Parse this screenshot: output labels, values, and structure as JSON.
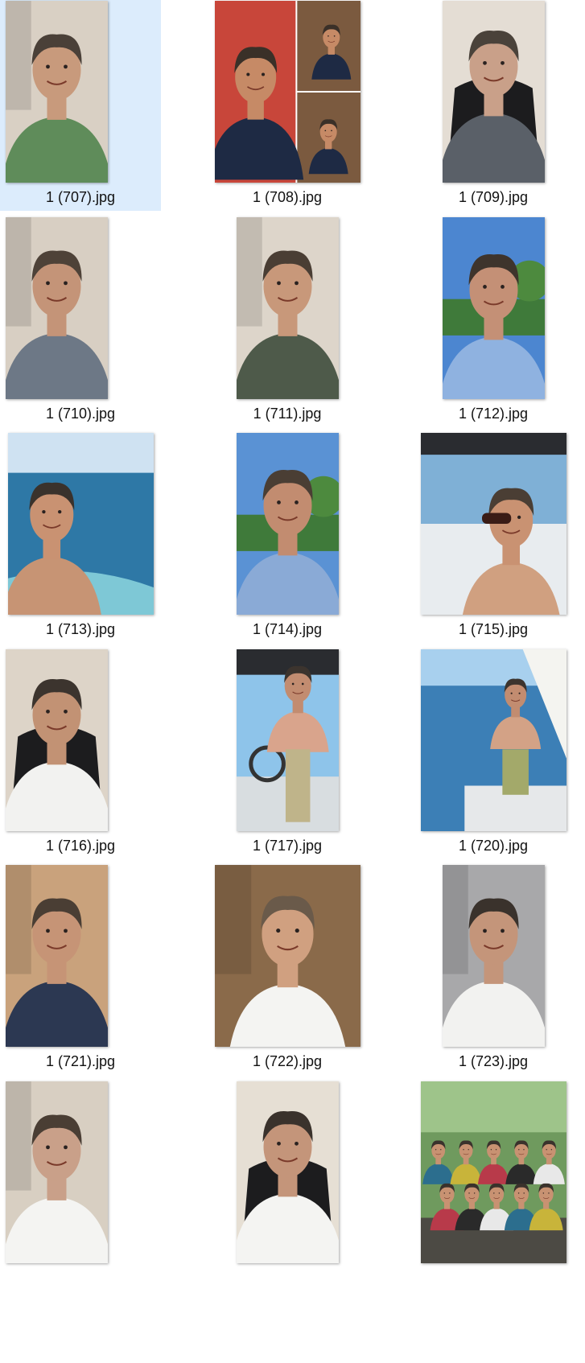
{
  "files": [
    {
      "name": "1 (707).jpg",
      "selected": true,
      "shape": "portrait",
      "scene": "selfie-indoor",
      "colors": {
        "bg": "#d9d0c4",
        "shirt": "#5f8c5a",
        "hair": "#4a4038",
        "skin": "#c89a7c"
      }
    },
    {
      "name": "1 (708).jpg",
      "selected": false,
      "shape": "landscape",
      "scene": "collage",
      "colors": {
        "bg": "#c8463a",
        "shirt": "#1e2a44",
        "hair": "#3a3028",
        "skin": "#c68a66"
      }
    },
    {
      "name": "1 (709).jpg",
      "selected": false,
      "shape": "portrait",
      "scene": "selfie-chair",
      "colors": {
        "bg": "#e4ddd4",
        "shirt": "#5a6068",
        "hair": "#4a423a",
        "skin": "#c9a089"
      }
    },
    {
      "name": "1 (710).jpg",
      "selected": false,
      "shape": "portrait",
      "scene": "selfie-indoor",
      "colors": {
        "bg": "#d8cfc3",
        "shirt": "#6d7886",
        "hair": "#4e4238",
        "skin": "#c49478"
      }
    },
    {
      "name": "1 (711).jpg",
      "selected": false,
      "shape": "portrait",
      "scene": "selfie-indoor",
      "colors": {
        "bg": "#ddd5ca",
        "shirt": "#4e5a4a",
        "hair": "#4a3e34",
        "skin": "#c8987a"
      }
    },
    {
      "name": "1 (712).jpg",
      "selected": false,
      "shape": "portrait",
      "scene": "selfie-outdoor",
      "colors": {
        "bg": "#4c86d0",
        "shirt": "#8fb2e0",
        "hair": "#3e342c",
        "skin": "#c49076"
      }
    },
    {
      "name": "1 (713).jpg",
      "selected": false,
      "shape": "landscape",
      "scene": "sea",
      "colors": {
        "bg": "#3f88b4",
        "shirt": "#c79474",
        "hair": "#3a322c",
        "skin": "#c99272"
      }
    },
    {
      "name": "1 (714).jpg",
      "selected": false,
      "shape": "portrait",
      "scene": "selfie-outdoor",
      "colors": {
        "bg": "#5a92d4",
        "shirt": "#8aaad6",
        "hair": "#4a3e34",
        "skin": "#c28c70"
      }
    },
    {
      "name": "1 (715).jpg",
      "selected": false,
      "shape": "landscape",
      "scene": "boat-selfie",
      "colors": {
        "bg": "#7fb0d6",
        "shirt": "#d0a080",
        "hair": "#4a3e34",
        "skin": "#c99272"
      }
    },
    {
      "name": "1 (716).jpg",
      "selected": false,
      "shape": "portrait",
      "scene": "selfie-chair",
      "colors": {
        "bg": "#ddd4c8",
        "shirt": "#f2f2f0",
        "hair": "#3c342e",
        "skin": "#c29274"
      }
    },
    {
      "name": "1 (717).jpg",
      "selected": false,
      "shape": "portrait",
      "scene": "boat-standing",
      "colors": {
        "bg": "#8ec4ea",
        "shirt": "#d9a48c",
        "hair": "#3c342e",
        "skin": "#c28c70"
      }
    },
    {
      "name": "1 (720).jpg",
      "selected": false,
      "shape": "landscape",
      "scene": "sail",
      "colors": {
        "bg": "#3c7fb6",
        "shirt": "#d3a286",
        "hair": "#3c342e",
        "skin": "#c28c70"
      }
    },
    {
      "name": "1 (721).jpg",
      "selected": false,
      "shape": "portrait",
      "scene": "selfie-indoor",
      "colors": {
        "bg": "#c9a27c",
        "shirt": "#2c3852",
        "hair": "#4a3e34",
        "skin": "#c69476"
      }
    },
    {
      "name": "1 (722).jpg",
      "selected": false,
      "shape": "landscape",
      "scene": "selfie-indoor",
      "colors": {
        "bg": "#8a6a4a",
        "shirt": "#f4f4f2",
        "hair": "#6a5a4a",
        "skin": "#d0a080"
      }
    },
    {
      "name": "1 (723).jpg",
      "selected": false,
      "shape": "portrait",
      "scene": "selfie-indoor",
      "colors": {
        "bg": "#a8a8aa",
        "shirt": "#f2f2f0",
        "hair": "#3a322c",
        "skin": "#c4957a"
      }
    },
    {
      "name": "",
      "selected": false,
      "shape": "portrait",
      "scene": "selfie-indoor",
      "colors": {
        "bg": "#d8cfc2",
        "shirt": "#f4f4f2",
        "hair": "#4a3e34",
        "skin": "#c9a089"
      }
    },
    {
      "name": "",
      "selected": false,
      "shape": "portrait",
      "scene": "selfie-chair",
      "colors": {
        "bg": "#e6dfd4",
        "shirt": "#f4f4f2",
        "hair": "#3a322c",
        "skin": "#c4957a"
      }
    },
    {
      "name": "",
      "selected": false,
      "shape": "landscape",
      "scene": "group",
      "colors": {
        "bg": "#6f9a5e",
        "shirt": "#2a2a2a",
        "hair": "#3a322c",
        "skin": "#c89272"
      }
    }
  ]
}
